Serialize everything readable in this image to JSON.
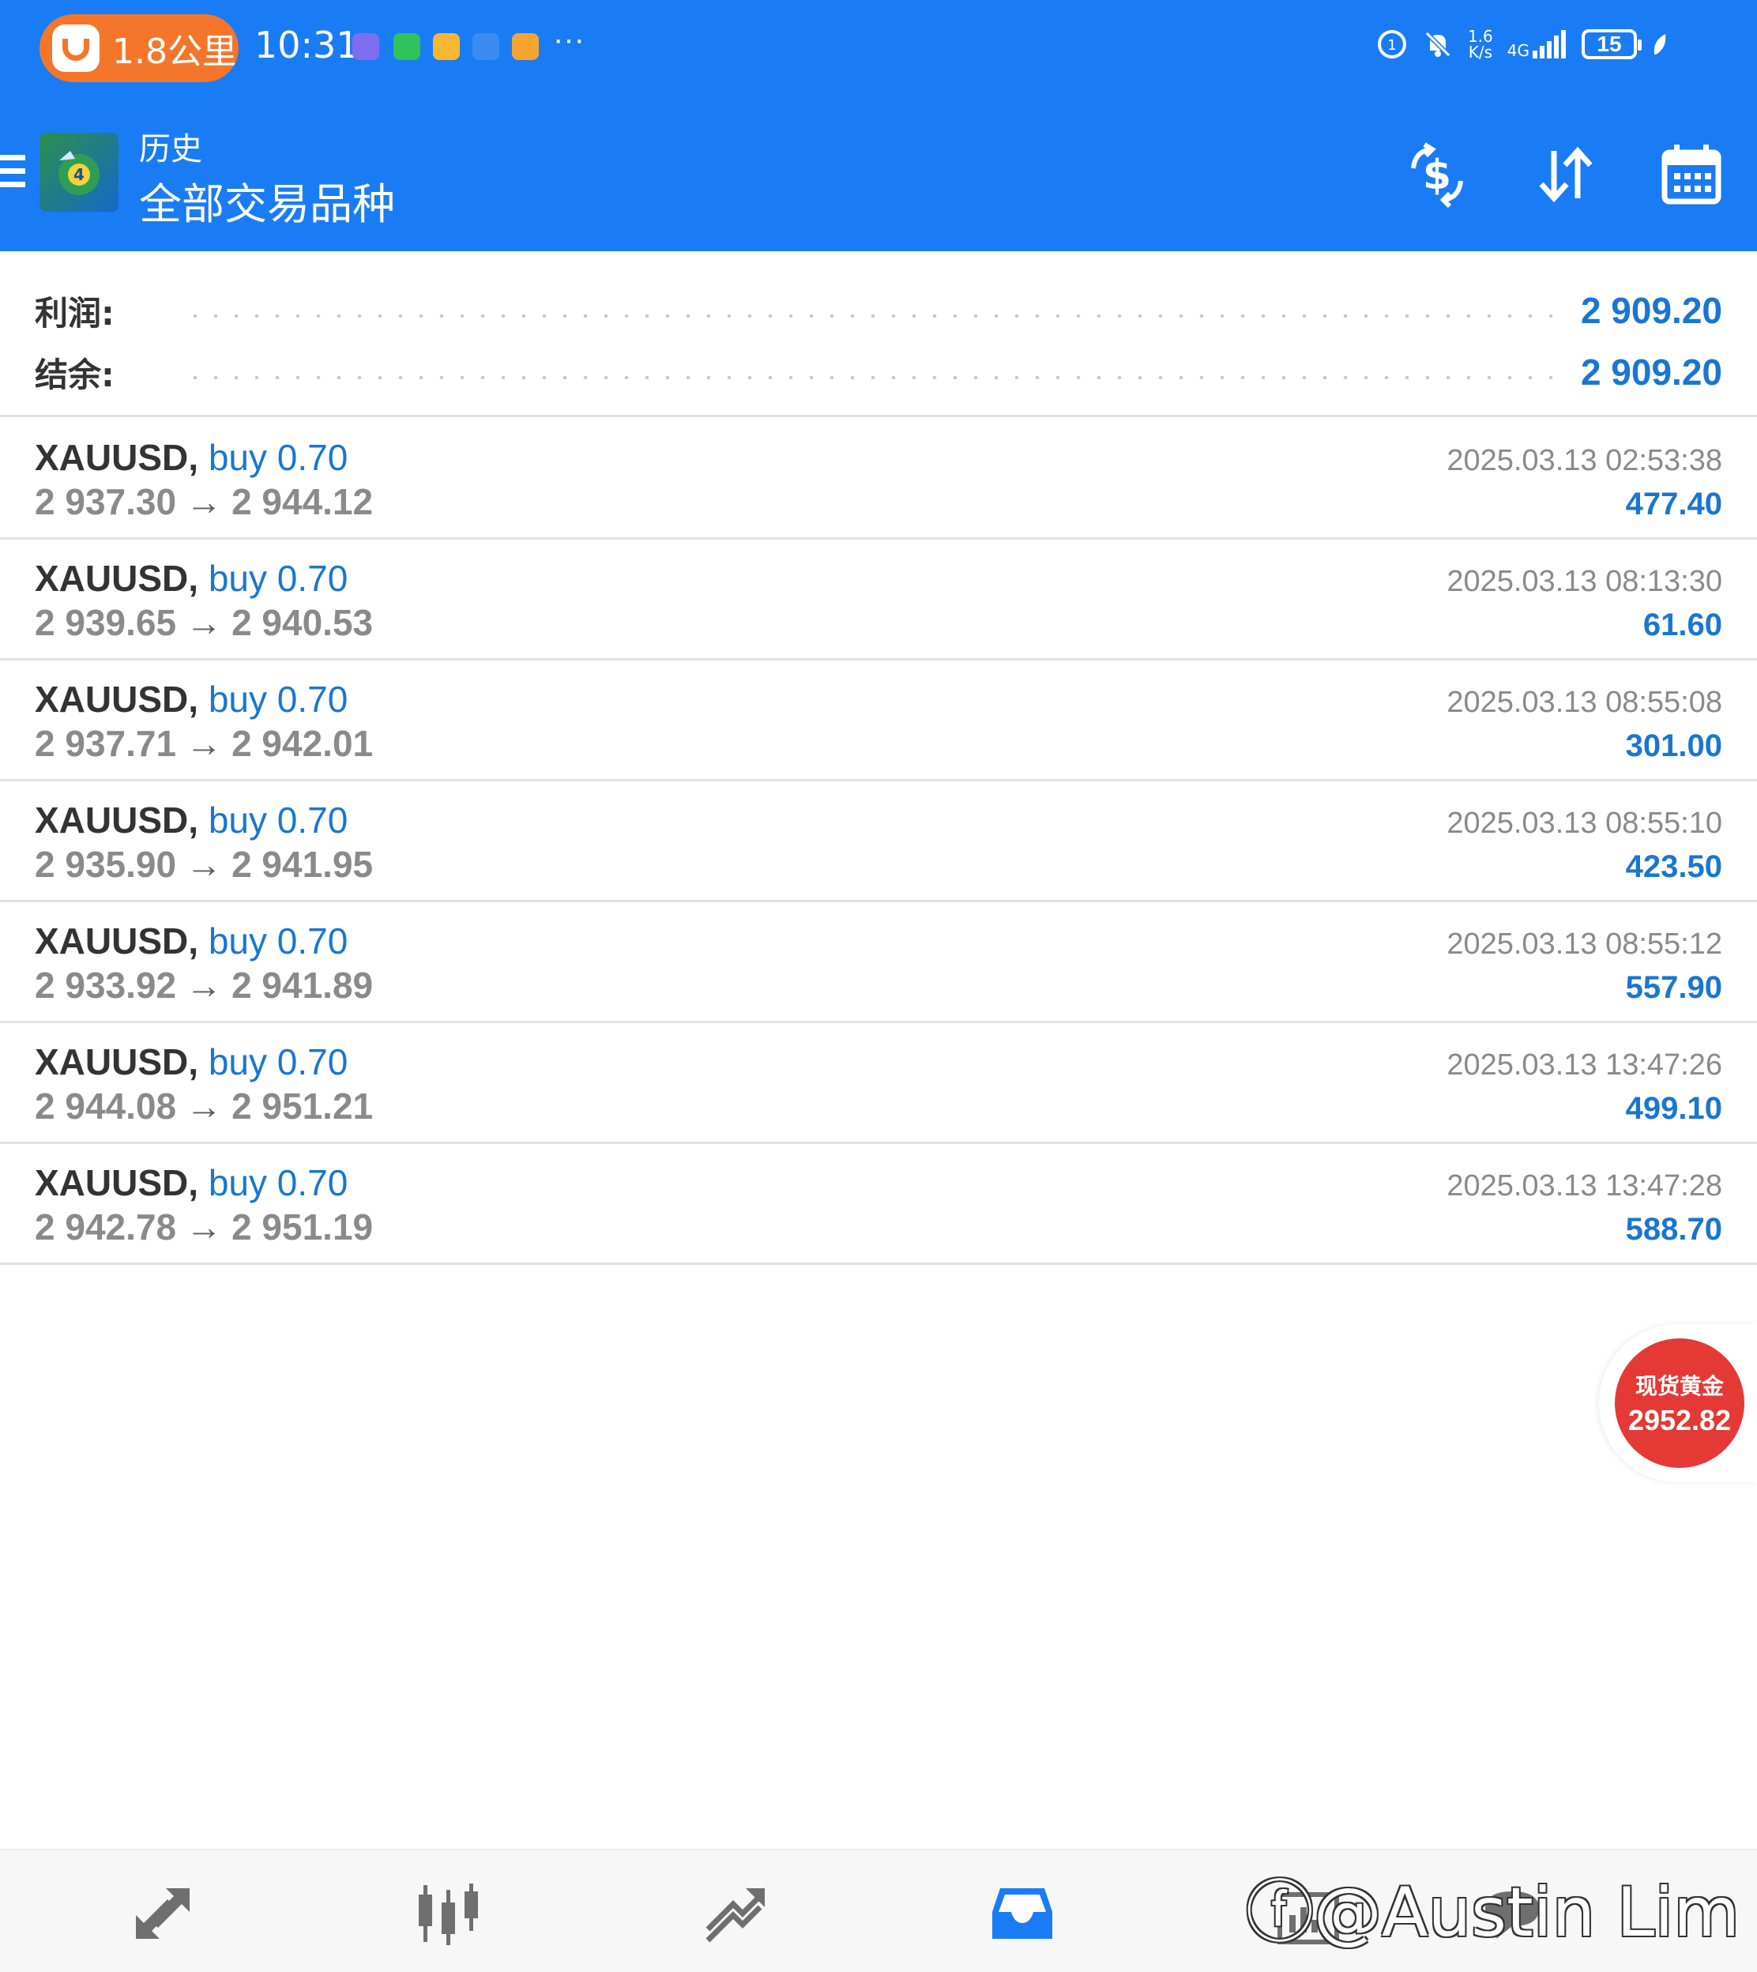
{
  "status_bar": {
    "pill_text": "1.8公里",
    "time": "10:31",
    "more": "···",
    "net_speed_top": "1.6",
    "net_speed_bottom": "K/s",
    "network": "4G",
    "battery": "15"
  },
  "header": {
    "section": "历史",
    "filter": "全部交易品种"
  },
  "summary": {
    "profit_label": "利润:",
    "profit_value": "2 909.20",
    "balance_label": "结余:",
    "balance_value": "2 909.20"
  },
  "deals": [
    {
      "symbol": "XAUUSD,",
      "side": "buy 0.70",
      "open": "2 937.30",
      "close": "2 944.12",
      "time": "2025.03.13 02:53:38",
      "profit": "477.40"
    },
    {
      "symbol": "XAUUSD,",
      "side": "buy 0.70",
      "open": "2 939.65",
      "close": "2 940.53",
      "time": "2025.03.13 08:13:30",
      "profit": "61.60"
    },
    {
      "symbol": "XAUUSD,",
      "side": "buy 0.70",
      "open": "2 937.71",
      "close": "2 942.01",
      "time": "2025.03.13 08:55:08",
      "profit": "301.00"
    },
    {
      "symbol": "XAUUSD,",
      "side": "buy 0.70",
      "open": "2 935.90",
      "close": "2 941.95",
      "time": "2025.03.13 08:55:10",
      "profit": "423.50"
    },
    {
      "symbol": "XAUUSD,",
      "side": "buy 0.70",
      "open": "2 933.92",
      "close": "2 941.89",
      "time": "2025.03.13 08:55:12",
      "profit": "557.90"
    },
    {
      "symbol": "XAUUSD,",
      "side": "buy 0.70",
      "open": "2 944.08",
      "close": "2 951.21",
      "time": "2025.03.13 13:47:26",
      "profit": "499.10"
    },
    {
      "symbol": "XAUUSD,",
      "side": "buy 0.70",
      "open": "2 942.78",
      "close": "2 951.19",
      "time": "2025.03.13 13:47:28",
      "profit": "588.70"
    }
  ],
  "arrow_glyph": "→",
  "floating_badge": {
    "label": "现货黄金",
    "value": "2952.82"
  },
  "watermark": "@Austin Lim",
  "icons": {
    "header_actions": [
      "currency-exchange-icon",
      "sort-icon",
      "calendar-icon"
    ],
    "bottom_nav": [
      "quotes-icon",
      "chart-icon",
      "trade-icon",
      "history-icon",
      "news-icon",
      "messages-icon"
    ]
  },
  "colors": {
    "brand_blue": "#1a7cf5",
    "value_blue": "#1976d2",
    "badge_red": "#e53935",
    "pill_orange": "#f5762a"
  }
}
